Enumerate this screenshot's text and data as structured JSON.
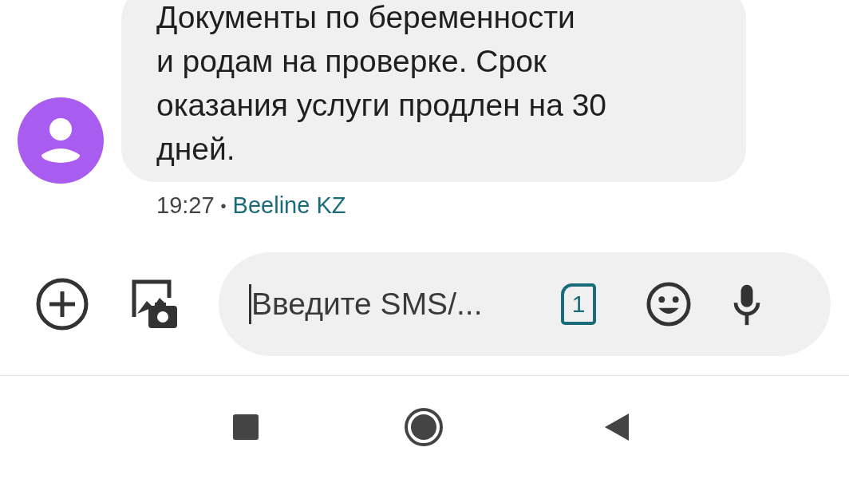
{
  "message": {
    "text": "Документы по беременности\nи родам на проверке. Срок\nоказания услуги продлен на 30\nдней.",
    "time": "19:27",
    "separator": "•",
    "sender": "Beeline KZ"
  },
  "composer": {
    "placeholder": "Введите SMS/...",
    "sim": "1"
  }
}
